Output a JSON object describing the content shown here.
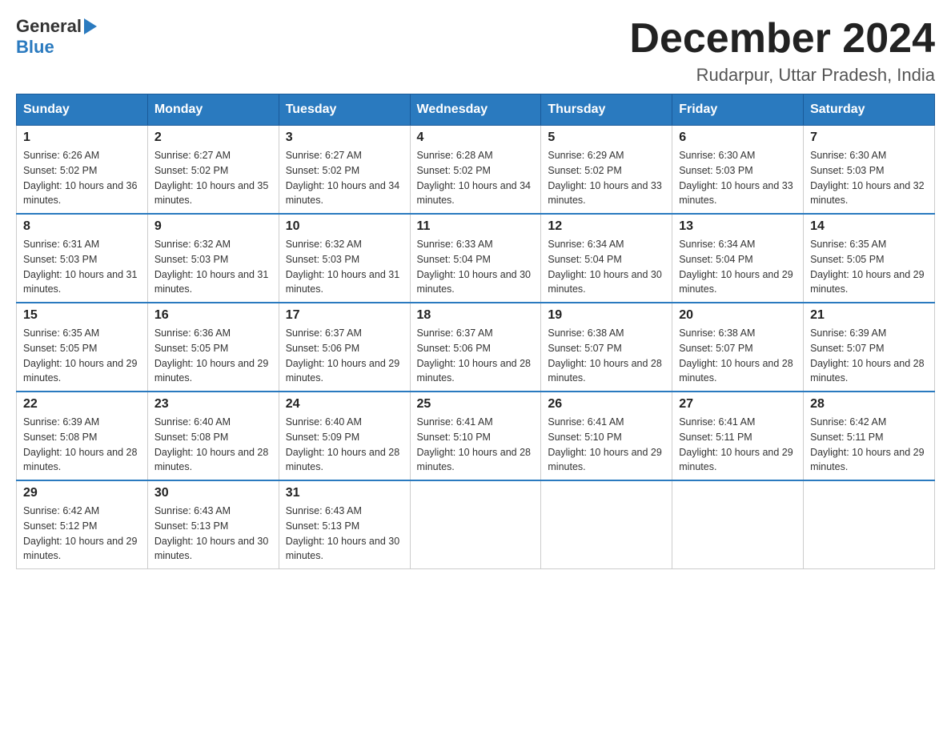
{
  "header": {
    "logo_general": "General",
    "logo_blue": "Blue",
    "main_title": "December 2024",
    "subtitle": "Rudarpur, Uttar Pradesh, India"
  },
  "days_of_week": [
    "Sunday",
    "Monday",
    "Tuesday",
    "Wednesday",
    "Thursday",
    "Friday",
    "Saturday"
  ],
  "weeks": [
    [
      {
        "day": "1",
        "sunrise": "Sunrise: 6:26 AM",
        "sunset": "Sunset: 5:02 PM",
        "daylight": "Daylight: 10 hours and 36 minutes."
      },
      {
        "day": "2",
        "sunrise": "Sunrise: 6:27 AM",
        "sunset": "Sunset: 5:02 PM",
        "daylight": "Daylight: 10 hours and 35 minutes."
      },
      {
        "day": "3",
        "sunrise": "Sunrise: 6:27 AM",
        "sunset": "Sunset: 5:02 PM",
        "daylight": "Daylight: 10 hours and 34 minutes."
      },
      {
        "day": "4",
        "sunrise": "Sunrise: 6:28 AM",
        "sunset": "Sunset: 5:02 PM",
        "daylight": "Daylight: 10 hours and 34 minutes."
      },
      {
        "day": "5",
        "sunrise": "Sunrise: 6:29 AM",
        "sunset": "Sunset: 5:02 PM",
        "daylight": "Daylight: 10 hours and 33 minutes."
      },
      {
        "day": "6",
        "sunrise": "Sunrise: 6:30 AM",
        "sunset": "Sunset: 5:03 PM",
        "daylight": "Daylight: 10 hours and 33 minutes."
      },
      {
        "day": "7",
        "sunrise": "Sunrise: 6:30 AM",
        "sunset": "Sunset: 5:03 PM",
        "daylight": "Daylight: 10 hours and 32 minutes."
      }
    ],
    [
      {
        "day": "8",
        "sunrise": "Sunrise: 6:31 AM",
        "sunset": "Sunset: 5:03 PM",
        "daylight": "Daylight: 10 hours and 31 minutes."
      },
      {
        "day": "9",
        "sunrise": "Sunrise: 6:32 AM",
        "sunset": "Sunset: 5:03 PM",
        "daylight": "Daylight: 10 hours and 31 minutes."
      },
      {
        "day": "10",
        "sunrise": "Sunrise: 6:32 AM",
        "sunset": "Sunset: 5:03 PM",
        "daylight": "Daylight: 10 hours and 31 minutes."
      },
      {
        "day": "11",
        "sunrise": "Sunrise: 6:33 AM",
        "sunset": "Sunset: 5:04 PM",
        "daylight": "Daylight: 10 hours and 30 minutes."
      },
      {
        "day": "12",
        "sunrise": "Sunrise: 6:34 AM",
        "sunset": "Sunset: 5:04 PM",
        "daylight": "Daylight: 10 hours and 30 minutes."
      },
      {
        "day": "13",
        "sunrise": "Sunrise: 6:34 AM",
        "sunset": "Sunset: 5:04 PM",
        "daylight": "Daylight: 10 hours and 29 minutes."
      },
      {
        "day": "14",
        "sunrise": "Sunrise: 6:35 AM",
        "sunset": "Sunset: 5:05 PM",
        "daylight": "Daylight: 10 hours and 29 minutes."
      }
    ],
    [
      {
        "day": "15",
        "sunrise": "Sunrise: 6:35 AM",
        "sunset": "Sunset: 5:05 PM",
        "daylight": "Daylight: 10 hours and 29 minutes."
      },
      {
        "day": "16",
        "sunrise": "Sunrise: 6:36 AM",
        "sunset": "Sunset: 5:05 PM",
        "daylight": "Daylight: 10 hours and 29 minutes."
      },
      {
        "day": "17",
        "sunrise": "Sunrise: 6:37 AM",
        "sunset": "Sunset: 5:06 PM",
        "daylight": "Daylight: 10 hours and 29 minutes."
      },
      {
        "day": "18",
        "sunrise": "Sunrise: 6:37 AM",
        "sunset": "Sunset: 5:06 PM",
        "daylight": "Daylight: 10 hours and 28 minutes."
      },
      {
        "day": "19",
        "sunrise": "Sunrise: 6:38 AM",
        "sunset": "Sunset: 5:07 PM",
        "daylight": "Daylight: 10 hours and 28 minutes."
      },
      {
        "day": "20",
        "sunrise": "Sunrise: 6:38 AM",
        "sunset": "Sunset: 5:07 PM",
        "daylight": "Daylight: 10 hours and 28 minutes."
      },
      {
        "day": "21",
        "sunrise": "Sunrise: 6:39 AM",
        "sunset": "Sunset: 5:07 PM",
        "daylight": "Daylight: 10 hours and 28 minutes."
      }
    ],
    [
      {
        "day": "22",
        "sunrise": "Sunrise: 6:39 AM",
        "sunset": "Sunset: 5:08 PM",
        "daylight": "Daylight: 10 hours and 28 minutes."
      },
      {
        "day": "23",
        "sunrise": "Sunrise: 6:40 AM",
        "sunset": "Sunset: 5:08 PM",
        "daylight": "Daylight: 10 hours and 28 minutes."
      },
      {
        "day": "24",
        "sunrise": "Sunrise: 6:40 AM",
        "sunset": "Sunset: 5:09 PM",
        "daylight": "Daylight: 10 hours and 28 minutes."
      },
      {
        "day": "25",
        "sunrise": "Sunrise: 6:41 AM",
        "sunset": "Sunset: 5:10 PM",
        "daylight": "Daylight: 10 hours and 28 minutes."
      },
      {
        "day": "26",
        "sunrise": "Sunrise: 6:41 AM",
        "sunset": "Sunset: 5:10 PM",
        "daylight": "Daylight: 10 hours and 29 minutes."
      },
      {
        "day": "27",
        "sunrise": "Sunrise: 6:41 AM",
        "sunset": "Sunset: 5:11 PM",
        "daylight": "Daylight: 10 hours and 29 minutes."
      },
      {
        "day": "28",
        "sunrise": "Sunrise: 6:42 AM",
        "sunset": "Sunset: 5:11 PM",
        "daylight": "Daylight: 10 hours and 29 minutes."
      }
    ],
    [
      {
        "day": "29",
        "sunrise": "Sunrise: 6:42 AM",
        "sunset": "Sunset: 5:12 PM",
        "daylight": "Daylight: 10 hours and 29 minutes."
      },
      {
        "day": "30",
        "sunrise": "Sunrise: 6:43 AM",
        "sunset": "Sunset: 5:13 PM",
        "daylight": "Daylight: 10 hours and 30 minutes."
      },
      {
        "day": "31",
        "sunrise": "Sunrise: 6:43 AM",
        "sunset": "Sunset: 5:13 PM",
        "daylight": "Daylight: 10 hours and 30 minutes."
      },
      null,
      null,
      null,
      null
    ]
  ]
}
